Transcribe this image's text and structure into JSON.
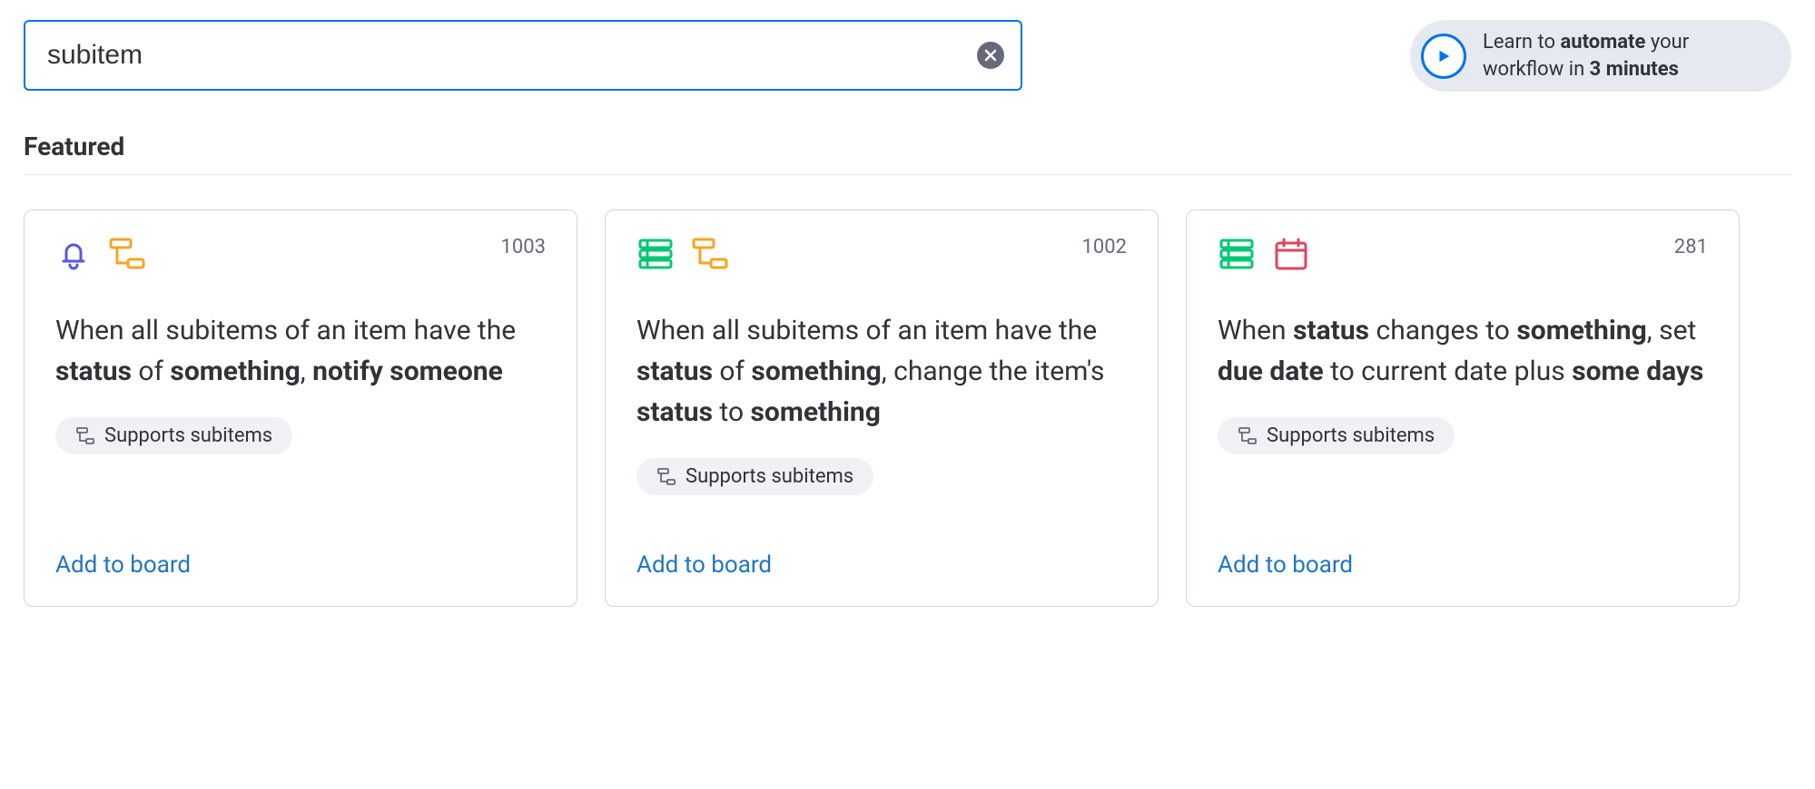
{
  "search": {
    "value": "subitem"
  },
  "learn": {
    "prefix": "Learn to ",
    "bold1": "automate",
    "mid": " your workflow in ",
    "bold2": "3 minutes"
  },
  "section_heading": "Featured",
  "supports_label": "Supports subitems",
  "add_label": "Add to board",
  "cards": [
    {
      "count": "1003",
      "icons": [
        "bell",
        "subitems-orange"
      ],
      "desc_parts": [
        {
          "t": "When all subitems of an item have the ",
          "b": false
        },
        {
          "t": "status",
          "b": true
        },
        {
          "t": " of ",
          "b": false
        },
        {
          "t": "something",
          "b": true
        },
        {
          "t": ", ",
          "b": false
        },
        {
          "t": "notify",
          "b": true
        },
        {
          "t": " ",
          "b": false
        },
        {
          "t": "someone",
          "b": true
        }
      ]
    },
    {
      "count": "1002",
      "icons": [
        "rows-green",
        "subitems-orange"
      ],
      "desc_parts": [
        {
          "t": "When all subitems of an item have the ",
          "b": false
        },
        {
          "t": "status",
          "b": true
        },
        {
          "t": " of ",
          "b": false
        },
        {
          "t": "something",
          "b": true
        },
        {
          "t": ", change the item's ",
          "b": false
        },
        {
          "t": "status",
          "b": true
        },
        {
          "t": " to ",
          "b": false
        },
        {
          "t": "something",
          "b": true
        }
      ]
    },
    {
      "count": "281",
      "icons": [
        "rows-green",
        "calendar-pink"
      ],
      "desc_parts": [
        {
          "t": "When ",
          "b": false
        },
        {
          "t": "status",
          "b": true
        },
        {
          "t": " changes to ",
          "b": false
        },
        {
          "t": "something",
          "b": true
        },
        {
          "t": ", set ",
          "b": false
        },
        {
          "t": "due date",
          "b": true
        },
        {
          "t": " to current date plus ",
          "b": false
        },
        {
          "t": "some days",
          "b": true
        }
      ]
    }
  ]
}
